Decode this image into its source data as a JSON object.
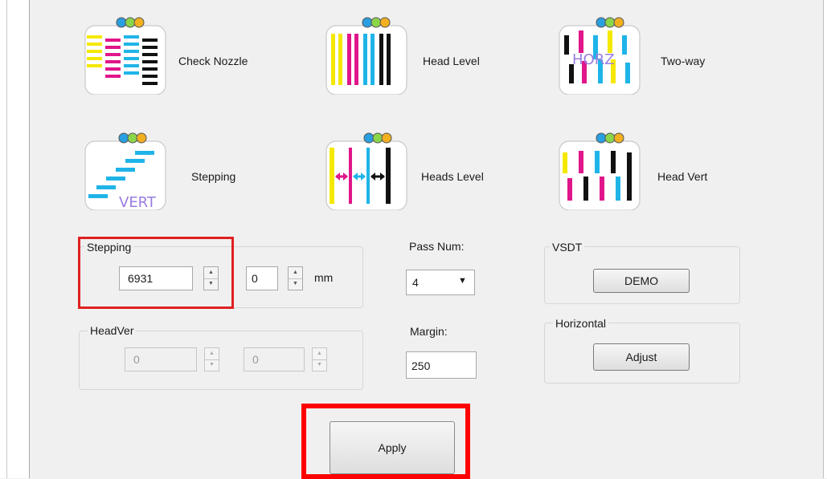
{
  "tools": [
    {
      "id": "check-nozzle",
      "label": "Check Nozzle"
    },
    {
      "id": "head-level",
      "label": "Head Level"
    },
    {
      "id": "two-way",
      "label": "Two-way",
      "icon_text": "HORZ"
    },
    {
      "id": "stepping",
      "label": "Stepping",
      "icon_text": "VERT"
    },
    {
      "id": "heads-level",
      "label": "Heads Level"
    },
    {
      "id": "head-vert",
      "label": "Head Vert"
    }
  ],
  "stepping_group": {
    "title": "Stepping",
    "value": "6931",
    "offset": "0",
    "unit": "mm"
  },
  "headver_group": {
    "title": "HeadVer",
    "value1": "0",
    "value2": "0"
  },
  "pass_num": {
    "label": "Pass Num:",
    "value": "4"
  },
  "margin": {
    "label": "Margin:",
    "value": "250"
  },
  "vsdt": {
    "title": "VSDT",
    "button": "DEMO"
  },
  "horizontal": {
    "title": "Horizontal",
    "button": "Adjust"
  },
  "apply_button": "Apply",
  "colors": {
    "cyan": "#1fb4e8",
    "magenta": "#e0168a",
    "yellow": "#f5e800",
    "black": "#111111",
    "highlight": "#e02020",
    "highlight_strong": "#ff0000"
  }
}
